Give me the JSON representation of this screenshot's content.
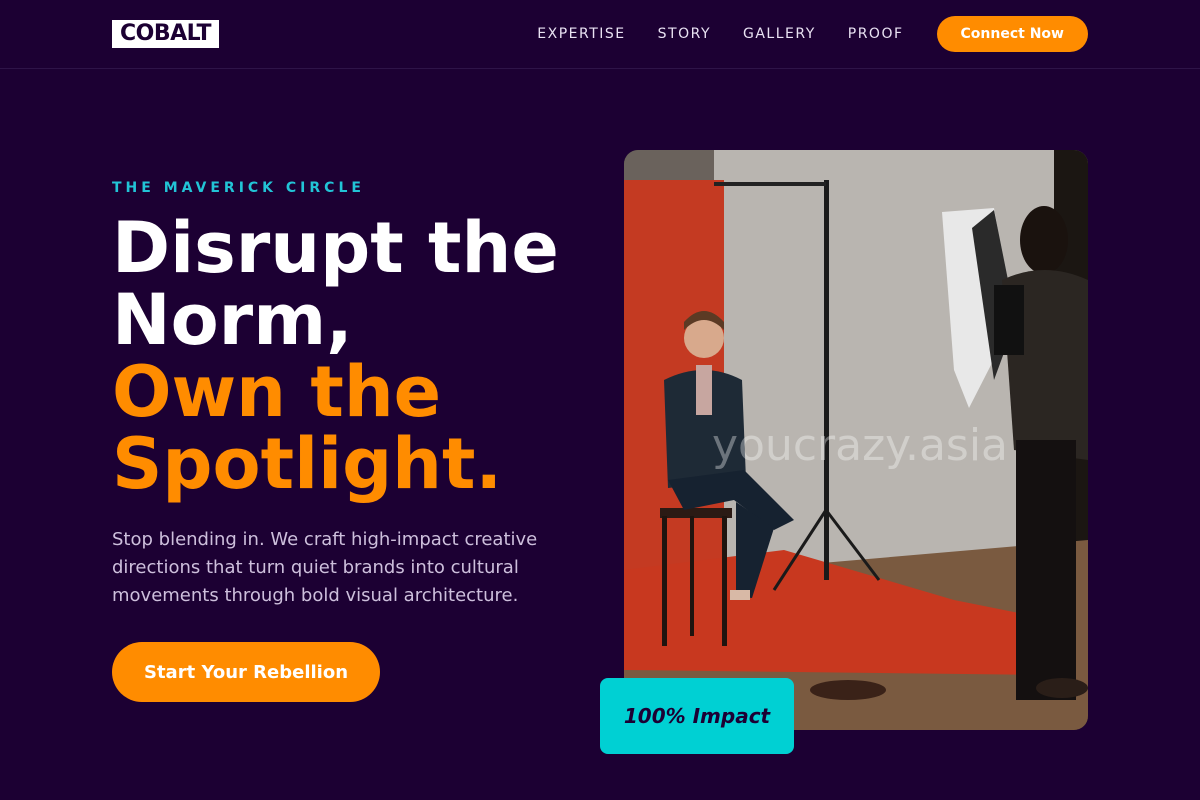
{
  "header": {
    "logo": "COBALT",
    "nav": [
      "EXPERTISE",
      "STORY",
      "GALLERY",
      "PROOF"
    ],
    "cta": "Connect Now"
  },
  "hero": {
    "eyebrow": "THE MAVERICK CIRCLE",
    "headline_white": [
      "Disrupt the",
      "Norm,"
    ],
    "headline_accent": [
      "Own the",
      "Spotlight."
    ],
    "lead": "Stop blending in. We craft high-impact creative directions that turn quiet brands into cultural movements through bold visual architecture.",
    "cta": "Start Your Rebellion"
  },
  "photo": {
    "watermark": "youcrazy.asia",
    "badge": "100% Impact"
  },
  "colors": {
    "background": "#1c0033",
    "accent": "#ff8c00",
    "teal": "#22c4d6",
    "badge": "#00d0d3"
  }
}
